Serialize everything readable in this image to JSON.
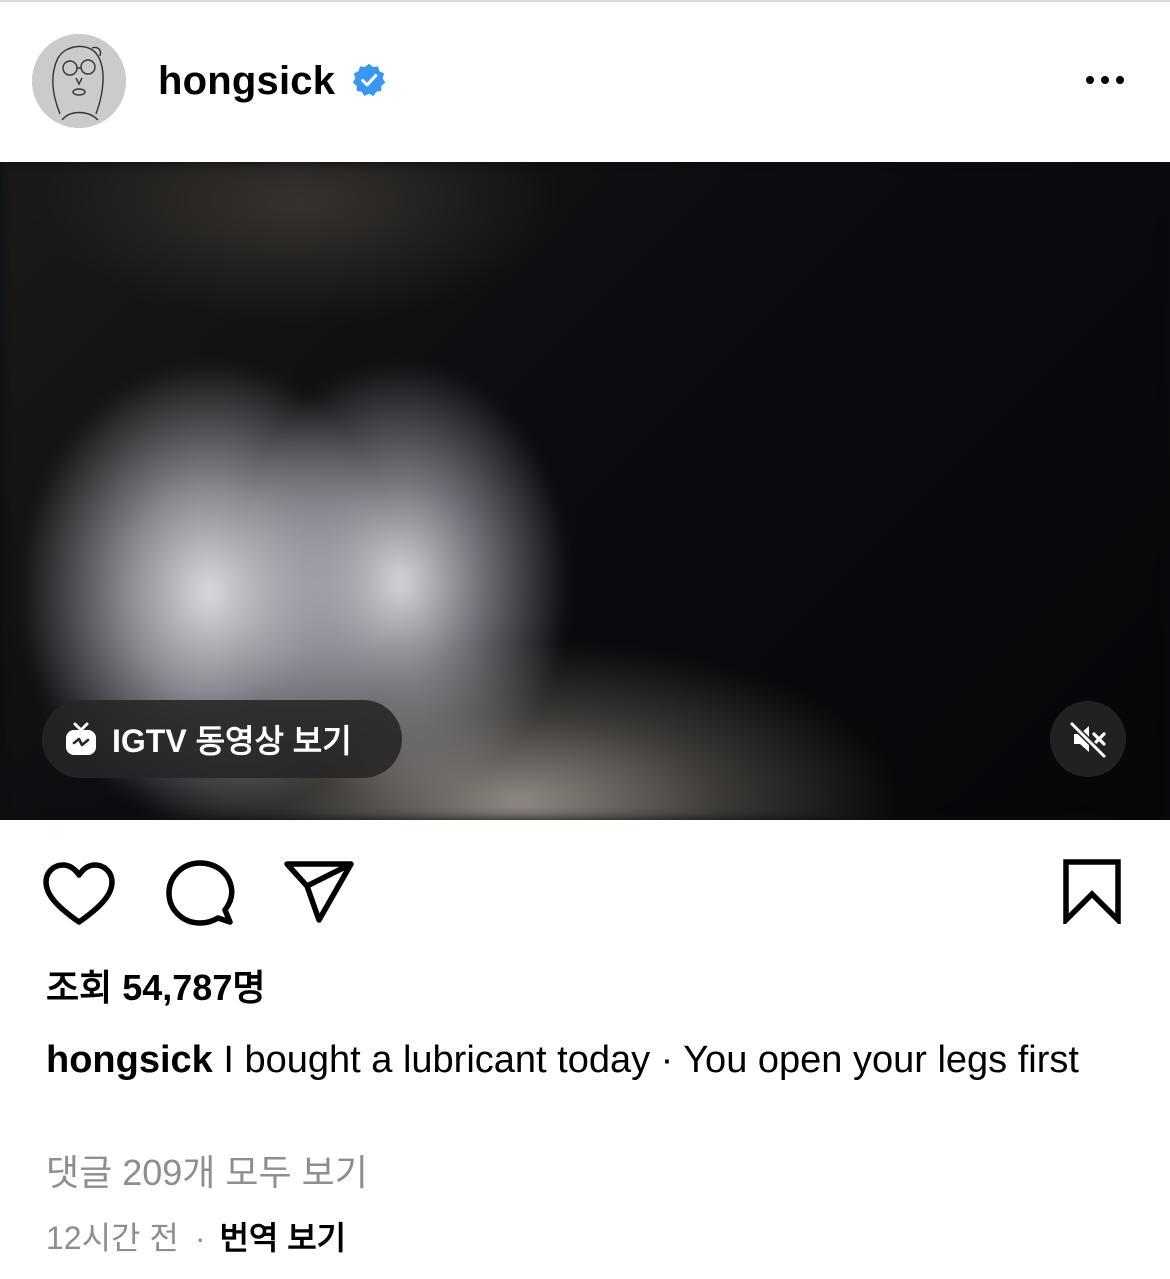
{
  "post": {
    "username": "hongsick",
    "verified": true,
    "menu_icon": "more-options-icon",
    "media": {
      "igtv_button_label": "IGTV 동영상 보기",
      "igtv_icon": "igtv-icon",
      "mute_icon": "muted-speaker-icon"
    },
    "actions": {
      "like_icon": "heart-icon",
      "comment_icon": "comment-bubble-icon",
      "share_icon": "paper-plane-icon",
      "save_icon": "bookmark-icon"
    },
    "views_text": "조회 54,787명",
    "caption": {
      "username": "hongsick",
      "text": "I bought a lubricant today · You open your legs first"
    },
    "view_comments_text": "댓글 209개 모두 보기",
    "timestamp": "12시간 전",
    "separator": "·",
    "translate_label": "번역 보기"
  },
  "colors": {
    "verified_blue": "#3897f0",
    "secondary_text": "#8e8e8e",
    "overlay_bg": "#262626"
  }
}
